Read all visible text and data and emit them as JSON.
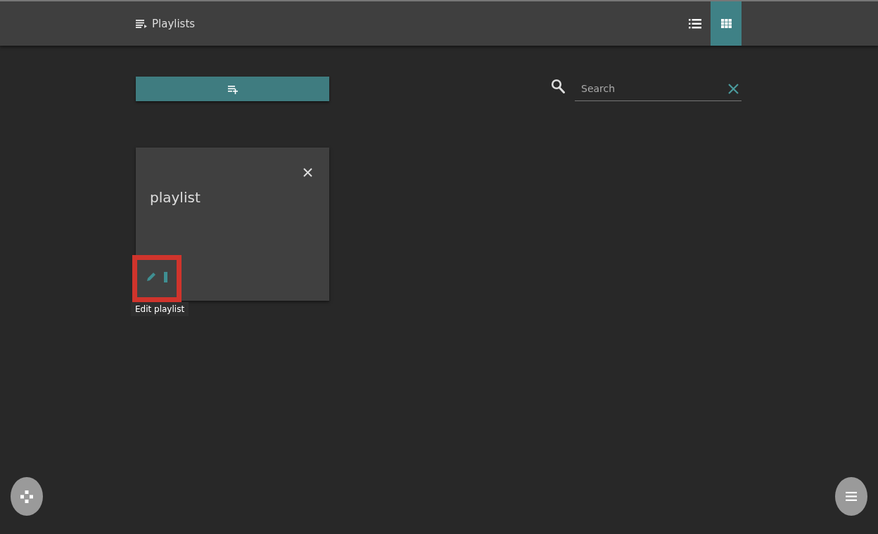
{
  "header": {
    "title": "Playlists"
  },
  "view_buttons": [
    {
      "kind": "list",
      "selected": false
    },
    {
      "kind": "grid",
      "selected": true
    }
  ],
  "search": {
    "placeholder": "Search"
  },
  "playlists": [
    {
      "title": "playlist",
      "highlighted": true,
      "tooltip": "Edit playlist"
    }
  ]
}
